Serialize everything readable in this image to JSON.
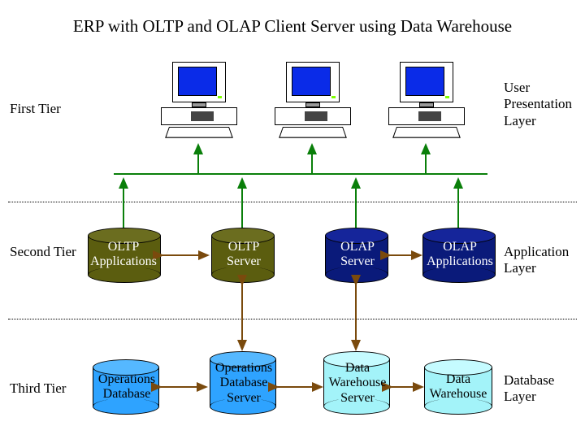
{
  "title": "ERP with OLTP and OLAP Client Server using Data Warehouse",
  "tiers": {
    "first": "First Tier",
    "second": "Second Tier",
    "third": "Third Tier"
  },
  "layers": {
    "user": "User\nPresentation\nLayer",
    "app": "Application\nLayer",
    "db": "Database\nLayer"
  },
  "nodes": {
    "oltp_apps": "OLTP\nApplications",
    "oltp_server": "OLTP\nServer",
    "olap_server": "OLAP\nServer",
    "olap_apps": "OLAP\nApplications",
    "ops_db": "Operations\nDatabase",
    "ops_db_server": "Operations\nDatabase\nServer",
    "dw_server": "Data\nWarehouse\nServer",
    "dw": "Data\nWarehouse"
  },
  "colors": {
    "screen": "#0a2be8",
    "olive": "#5b5d0f",
    "navy": "#0a1a7a",
    "blue": "#2ea3ff",
    "cyan": "#a3f3f9",
    "arrow_green": "#0a7f0a",
    "arrow_brown": "#7a4a0d"
  }
}
